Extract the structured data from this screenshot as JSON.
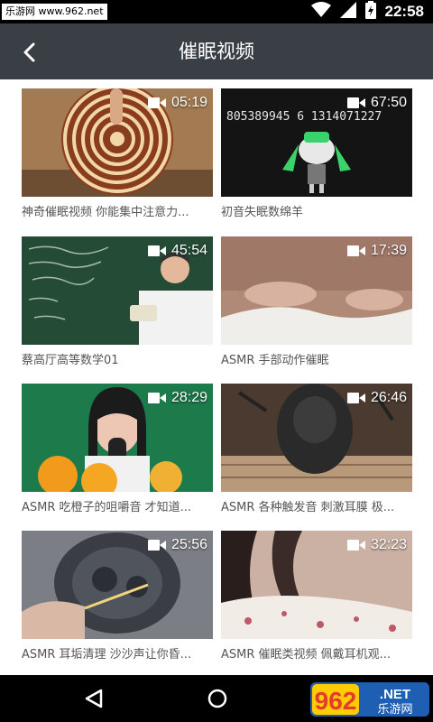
{
  "status": {
    "watermark": "乐游网 www.962.net",
    "time": "22:58"
  },
  "header": {
    "title": "催眠视频"
  },
  "videos": [
    {
      "title": "神奇催眠视频 你能集中注意力...",
      "duration": "05:19"
    },
    {
      "title": "初音失眠数绵羊",
      "duration": "67:50"
    },
    {
      "title": "蔡高厅高等数学01",
      "duration": "45:54"
    },
    {
      "title": "ASMR 手部动作催眠",
      "duration": "17:39"
    },
    {
      "title": "ASMR 吃橙子的咀嚼音 才知道...",
      "duration": "28:29"
    },
    {
      "title": "ASMR 各种触发音 刺激耳膜 极...",
      "duration": "26:46"
    },
    {
      "title": "ASMR 耳垢清理 沙沙声让你昏...",
      "duration": "25:56"
    },
    {
      "title": "ASMR 催眠类视频 佩戴耳机观...",
      "duration": "32:23"
    }
  ],
  "thumbnail_text": {
    "miku_numbers": "805389945 6 1314071227"
  },
  "watermark_logo": {
    "number": "962",
    "suffix": ".NET",
    "name": "乐游网"
  },
  "icons": {
    "back": "arrow-left-icon",
    "video": "video-camera-icon",
    "wifi": "wifi-icon",
    "signal": "signal-icon",
    "battery": "battery-icon",
    "nav_back": "triangle-back-icon",
    "nav_home": "circle-home-icon"
  },
  "colors": {
    "app_bar": "#3a3f46",
    "status_bar": "#000000",
    "title_text": "#555555"
  }
}
